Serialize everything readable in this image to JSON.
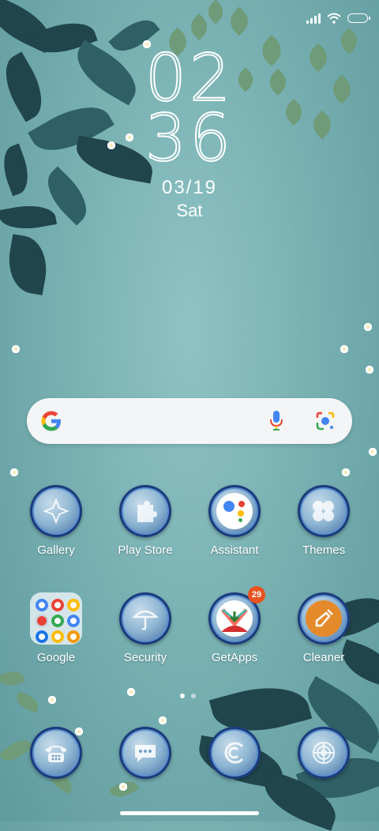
{
  "status_bar": {
    "icons": [
      "signal-icon",
      "wifi-icon",
      "battery-icon"
    ]
  },
  "clock": {
    "hour": "02",
    "minute": "36",
    "date": "03/19",
    "day": "Sat"
  },
  "search": {
    "icons": [
      "google-g-icon",
      "mic-icon",
      "lens-icon"
    ]
  },
  "apps_row1": [
    {
      "label": "Gallery",
      "icon": "gallery-icon"
    },
    {
      "label": "Play Store",
      "icon": "play-store-icon"
    },
    {
      "label": "Assistant",
      "icon": "assistant-icon"
    },
    {
      "label": "Themes",
      "icon": "themes-icon"
    }
  ],
  "apps_row2": [
    {
      "label": "Google",
      "icon": "google-folder-icon"
    },
    {
      "label": "Security",
      "icon": "security-icon"
    },
    {
      "label": "GetApps",
      "icon": "getapps-icon",
      "badge": "29"
    },
    {
      "label": "Cleaner",
      "icon": "cleaner-icon"
    }
  ],
  "dock": [
    {
      "icon": "phone-icon"
    },
    {
      "icon": "messages-icon"
    },
    {
      "icon": "browser-icon"
    },
    {
      "icon": "camera-icon"
    }
  ],
  "page_indicator": {
    "pages": 2,
    "active": 1
  },
  "colors": {
    "wallpaper": "#79b1b3",
    "accent_badge": "#e8531f",
    "bubble_ring": "#1a3b7a"
  }
}
